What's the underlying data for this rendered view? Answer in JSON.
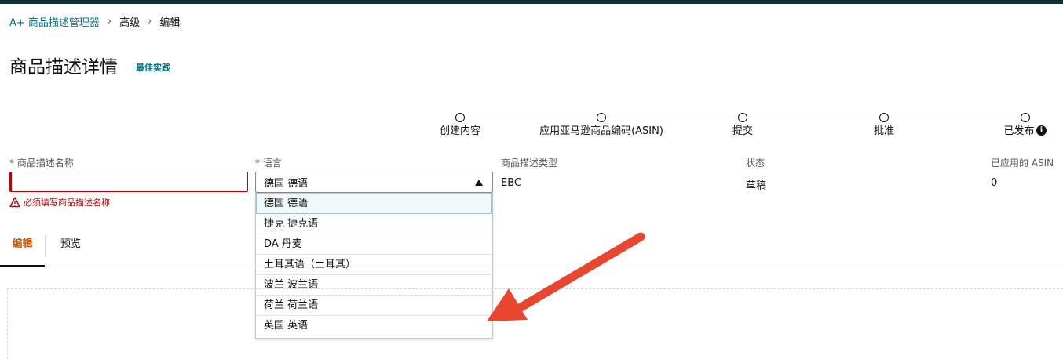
{
  "colors": {
    "top_bar": "#0f2f33",
    "link": "#007185",
    "error": "#c40000",
    "active_tab": "#c45500",
    "annotation_arrow": "#e8462e"
  },
  "breadcrumb": {
    "items": [
      "A+ 商品描述管理器",
      "高级",
      "编辑"
    ]
  },
  "page": {
    "title": "商品描述详情",
    "best_practices_link": "最佳实践"
  },
  "stepper": {
    "steps": [
      "创建内容",
      "应用亚马逊商品编码(ASIN)",
      "提交",
      "批准",
      "已发布"
    ],
    "info_icon": "info-icon"
  },
  "form": {
    "name_label": "* 商品描述名称",
    "name_value": "",
    "name_error": "必须填写商品描述名称",
    "language_label": "* 语言",
    "language_selected": "德国 德语",
    "language_options": [
      "德国 德语",
      "捷克 捷克语",
      "DA 丹麦",
      "土耳其语（土耳其）",
      "波兰 波兰语",
      "荷兰 荷兰语",
      "英国 英语"
    ],
    "type_label": "商品描述类型",
    "type_value": "EBC",
    "status_label": "状态",
    "status_value": "草稿",
    "asin_label": "已应用的 ASIN",
    "asin_value": "0"
  },
  "tabs": {
    "edit": "编辑",
    "preview": "预览",
    "active": "编辑"
  }
}
